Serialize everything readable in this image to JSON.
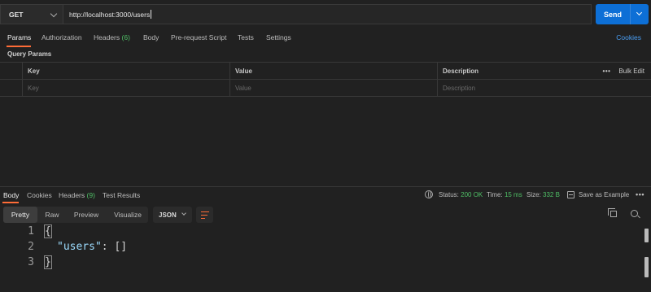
{
  "request": {
    "method": "GET",
    "url": "http://localhost:3000/users",
    "send_label": "Send"
  },
  "request_tabs": [
    {
      "label": "Params",
      "active": true
    },
    {
      "label": "Authorization"
    },
    {
      "label": "Headers",
      "count": "(6)"
    },
    {
      "label": "Body"
    },
    {
      "label": "Pre-request Script"
    },
    {
      "label": "Tests"
    },
    {
      "label": "Settings"
    }
  ],
  "cookies_link": "Cookies",
  "query_params": {
    "title": "Query Params",
    "headers": [
      "Key",
      "Value",
      "Description"
    ],
    "placeholders": [
      "Key",
      "Value",
      "Description"
    ],
    "bulk_edit": "Bulk Edit",
    "more": "•••"
  },
  "response_tabs": [
    {
      "label": "Body",
      "active": true
    },
    {
      "label": "Cookies"
    },
    {
      "label": "Headers",
      "count": "(9)"
    },
    {
      "label": "Test Results"
    }
  ],
  "response_status": {
    "status_label": "Status:",
    "status_value": "200 OK",
    "time_label": "Time:",
    "time_value": "15 ms",
    "size_label": "Size:",
    "size_value": "332 B",
    "save_label": "Save as Example",
    "more": "•••"
  },
  "view_modes": [
    "Pretty",
    "Raw",
    "Preview",
    "Visualize"
  ],
  "active_view": "Pretty",
  "format": "JSON",
  "code_lines": [
    {
      "num": "1",
      "text": "{"
    },
    {
      "num": "2",
      "key": "\"users\"",
      "rest": ": []"
    },
    {
      "num": "3",
      "text": "}"
    }
  ],
  "icons": {
    "method_dropdown": "chevron-down-icon",
    "send_dropdown": "chevron-down-icon",
    "network": "globe-icon",
    "save": "save-icon",
    "wrap": "wrap-lines-icon",
    "copy": "copy-icon",
    "search": "search-icon"
  },
  "colors": {
    "accent": "#ff6c37",
    "send": "#0d6fd6",
    "status_ok": "#4fbf66",
    "link": "#4a9ff5"
  }
}
